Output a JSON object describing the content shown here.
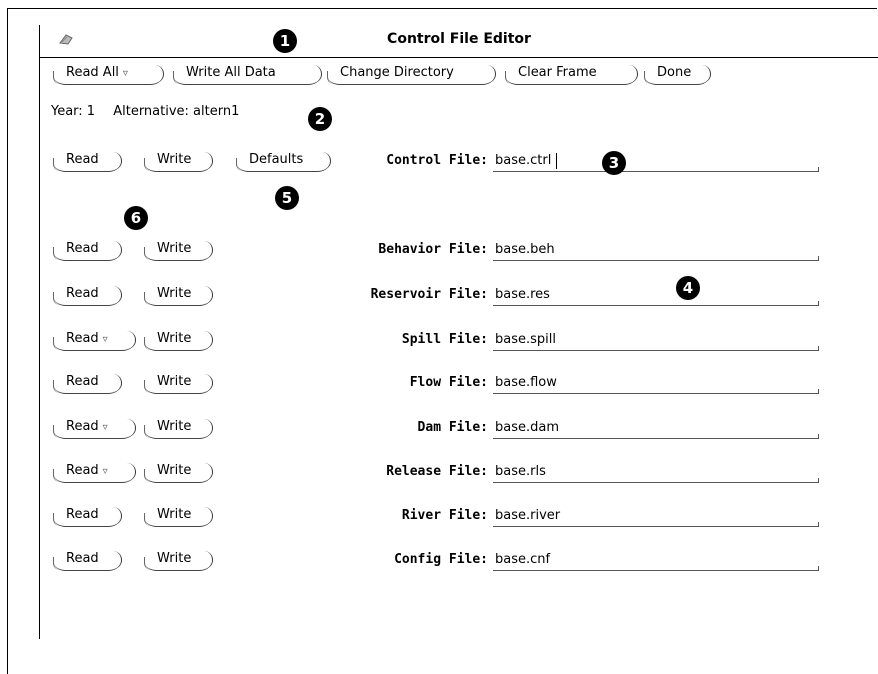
{
  "window": {
    "title": "Control File Editor"
  },
  "toolbar": {
    "read_all": "Read All",
    "write_all": "Write All Data",
    "change_dir": "Change Directory",
    "clear_frame": "Clear Frame",
    "done": "Done"
  },
  "status": {
    "year": "Year: 1",
    "alternative": "Alternative: altern1"
  },
  "control": {
    "read": "Read",
    "write": "Write",
    "defaults": "Defaults",
    "label": "Control File:",
    "value": "base.ctrl"
  },
  "files": [
    {
      "label": "Behavior File:",
      "value": "base.beh",
      "read": "Read",
      "write": "Write",
      "menu": false
    },
    {
      "label": "Reservoir File:",
      "value": "base.res",
      "read": "Read",
      "write": "Write",
      "menu": false
    },
    {
      "label": "Spill File:",
      "value": "base.spill",
      "read": "Read",
      "write": "Write",
      "menu": true
    },
    {
      "label": "Flow File:",
      "value": "base.flow",
      "read": "Read",
      "write": "Write",
      "menu": false
    },
    {
      "label": "Dam File:",
      "value": "base.dam",
      "read": "Read",
      "write": "Write",
      "menu": true
    },
    {
      "label": "Release File:",
      "value": "base.rls",
      "read": "Read",
      "write": "Write",
      "menu": true
    },
    {
      "label": "River File:",
      "value": "base.river",
      "read": "Read",
      "write": "Write",
      "menu": false
    },
    {
      "label": "Config File:",
      "value": "base.cnf",
      "read": "Read",
      "write": "Write",
      "menu": false
    }
  ],
  "callouts": [
    "1",
    "2",
    "3",
    "4",
    "5",
    "6"
  ]
}
